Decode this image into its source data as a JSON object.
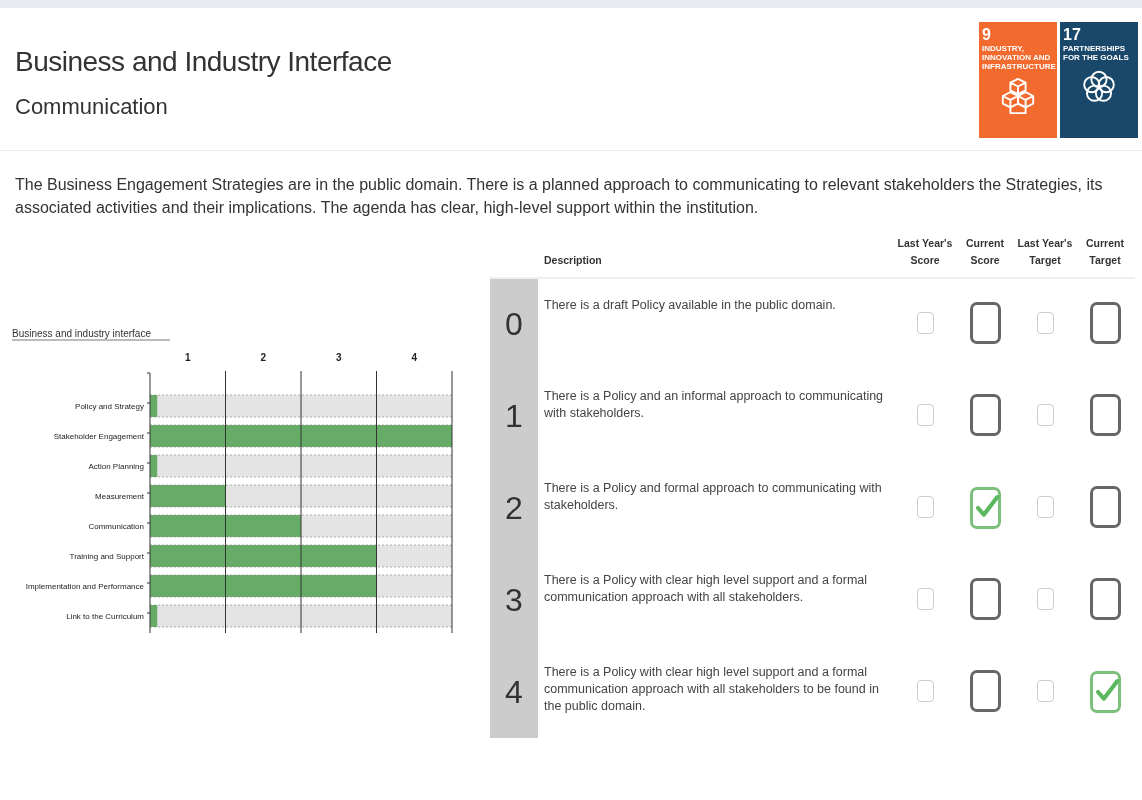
{
  "header": {
    "title": "Business and Industry Interface",
    "subtitle": "Communication"
  },
  "sdg_badges": [
    {
      "number": "9",
      "caption": "INDUSTRY, INNOVATION AND INFRASTRUCTURE",
      "kind": "industry",
      "color": "#f26a2e"
    },
    {
      "number": "17",
      "caption": "PARTNERSHIPS FOR THE GOALS",
      "kind": "partnership",
      "color": "#19486a"
    }
  ],
  "summary": "The Business Engagement Strategies are in the public domain. There is a planned approach to communicating to relevant stakeholders the Strategies, its associated activities and their implications. The agenda has clear, high-level support within the institution.",
  "chart_data": {
    "type": "bar",
    "orientation": "horizontal",
    "title": "Business and industry interface",
    "categories": [
      "Policy and Strategy",
      "Stakeholder Engagement",
      "Action Planning",
      "Measurement",
      "Communication",
      "Training and Support",
      "Implementation and Performance",
      "Link to the Curriculum"
    ],
    "series": [
      {
        "color": "#66ac66",
        "values": [
          0.1,
          4,
          0.1,
          1,
          2,
          3,
          3,
          0.1
        ]
      },
      {
        "color": "#e4e4e4",
        "values": [
          3.9,
          0,
          3.9,
          3,
          2,
          1,
          1,
          3.9
        ]
      }
    ],
    "stacked": true,
    "xlim": [
      0,
      4
    ],
    "xticks": [
      {
        "value": 0.5,
        "label": "1"
      },
      {
        "value": 1.5,
        "label": "2"
      },
      {
        "value": 2.5,
        "label": "3"
      },
      {
        "value": 3.5,
        "label": "4"
      }
    ]
  },
  "table": {
    "columns": [
      "Description",
      "Last Year's Score",
      "Current Score",
      "Last Year's Target",
      "Current Target"
    ],
    "rows": [
      {
        "level": "0",
        "description": "There is a draft Policy available in the public domain.",
        "last_year_score": false,
        "current_score": false,
        "last_year_target": false,
        "current_target": false
      },
      {
        "level": "1",
        "description": "There is a Policy and an informal approach to communicating with stakeholders.",
        "last_year_score": false,
        "current_score": false,
        "last_year_target": false,
        "current_target": false
      },
      {
        "level": "2",
        "description": "There is a Policy and formal approach to communicating with stakeholders.",
        "last_year_score": false,
        "current_score": true,
        "last_year_target": false,
        "current_target": false
      },
      {
        "level": "3",
        "description": "There is a Policy with clear high level support and a formal communication approach with all stakeholders.",
        "last_year_score": false,
        "current_score": false,
        "last_year_target": false,
        "current_target": false
      },
      {
        "level": "4",
        "description": "There is a Policy with clear high level support and a formal communication approach with all stakeholders to be found in the public domain.",
        "last_year_score": false,
        "current_score": false,
        "last_year_target": false,
        "current_target": true
      }
    ]
  }
}
